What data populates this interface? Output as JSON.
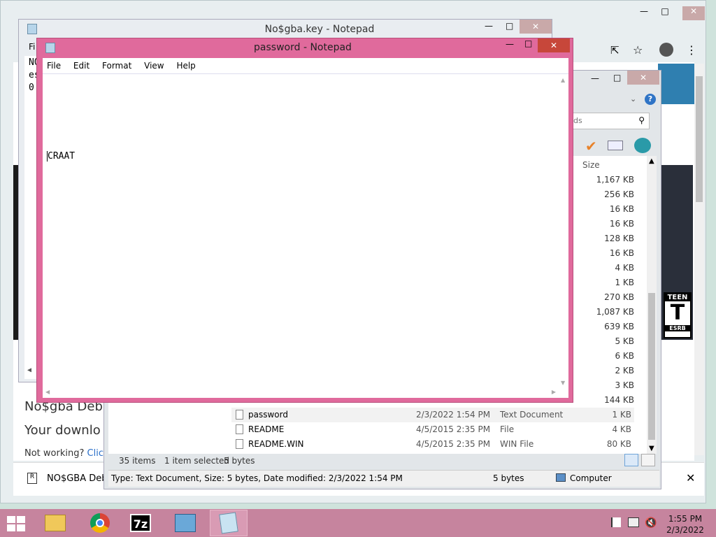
{
  "chrome": {
    "tab_partial": "",
    "page_heading_partial": "No$gba Deb",
    "page_subheading_partial": "Your downlo",
    "page_link_prefix": "Not working?",
    "page_link_partial": "Clic",
    "download_item_label": "NO$GBA Debu",
    "rating_top": "TEEN",
    "rating_letter": "T",
    "rating_bottom": "ESRB"
  },
  "notepad_back": {
    "title": "No$gba.key - Notepad",
    "menu_partial": "Fi",
    "text_lines": [
      "NO",
      "es",
      "0"
    ]
  },
  "notepad_front": {
    "title": "password - Notepad",
    "menu": [
      "File",
      "Edit",
      "Format",
      "View",
      "Help"
    ],
    "content": "CRAAT"
  },
  "explorer": {
    "search_placeholder_partial": "ds",
    "column_size": "Size",
    "sizes": [
      "1,167 KB",
      "256 KB",
      "16 KB",
      "16 KB",
      "128 KB",
      "16 KB",
      "4 KB",
      "1 KB",
      "270 KB",
      "1,087 KB",
      "639 KB",
      "5 KB",
      "6 KB",
      "2 KB",
      "3 KB",
      "144 KB"
    ],
    "rows": [
      {
        "name": "password",
        "date": "2/3/2022 1:54 PM",
        "type": "Text Document",
        "size": "1 KB",
        "selected": true
      },
      {
        "name": "README",
        "date": "4/5/2015 2:35 PM",
        "type": "File",
        "size": "4 KB",
        "selected": false
      },
      {
        "name": "README.WIN",
        "date": "4/5/2015 2:35 PM",
        "type": "WIN File",
        "size": "80 KB",
        "selected": false
      }
    ],
    "status_items": "35 items",
    "status_selected": "1 item selected",
    "status_bytes": "5 bytes",
    "details_bar": "Type: Text Document, Size: 5 bytes, Date modified: 2/3/2022 1:54 PM",
    "details_size": "5 bytes",
    "details_location": "Computer"
  },
  "taskbar": {
    "time": "1:55 PM",
    "date": "2/3/2022",
    "apps": [
      "file-explorer",
      "chrome",
      "7zip",
      "control-panel",
      "notepad"
    ]
  }
}
